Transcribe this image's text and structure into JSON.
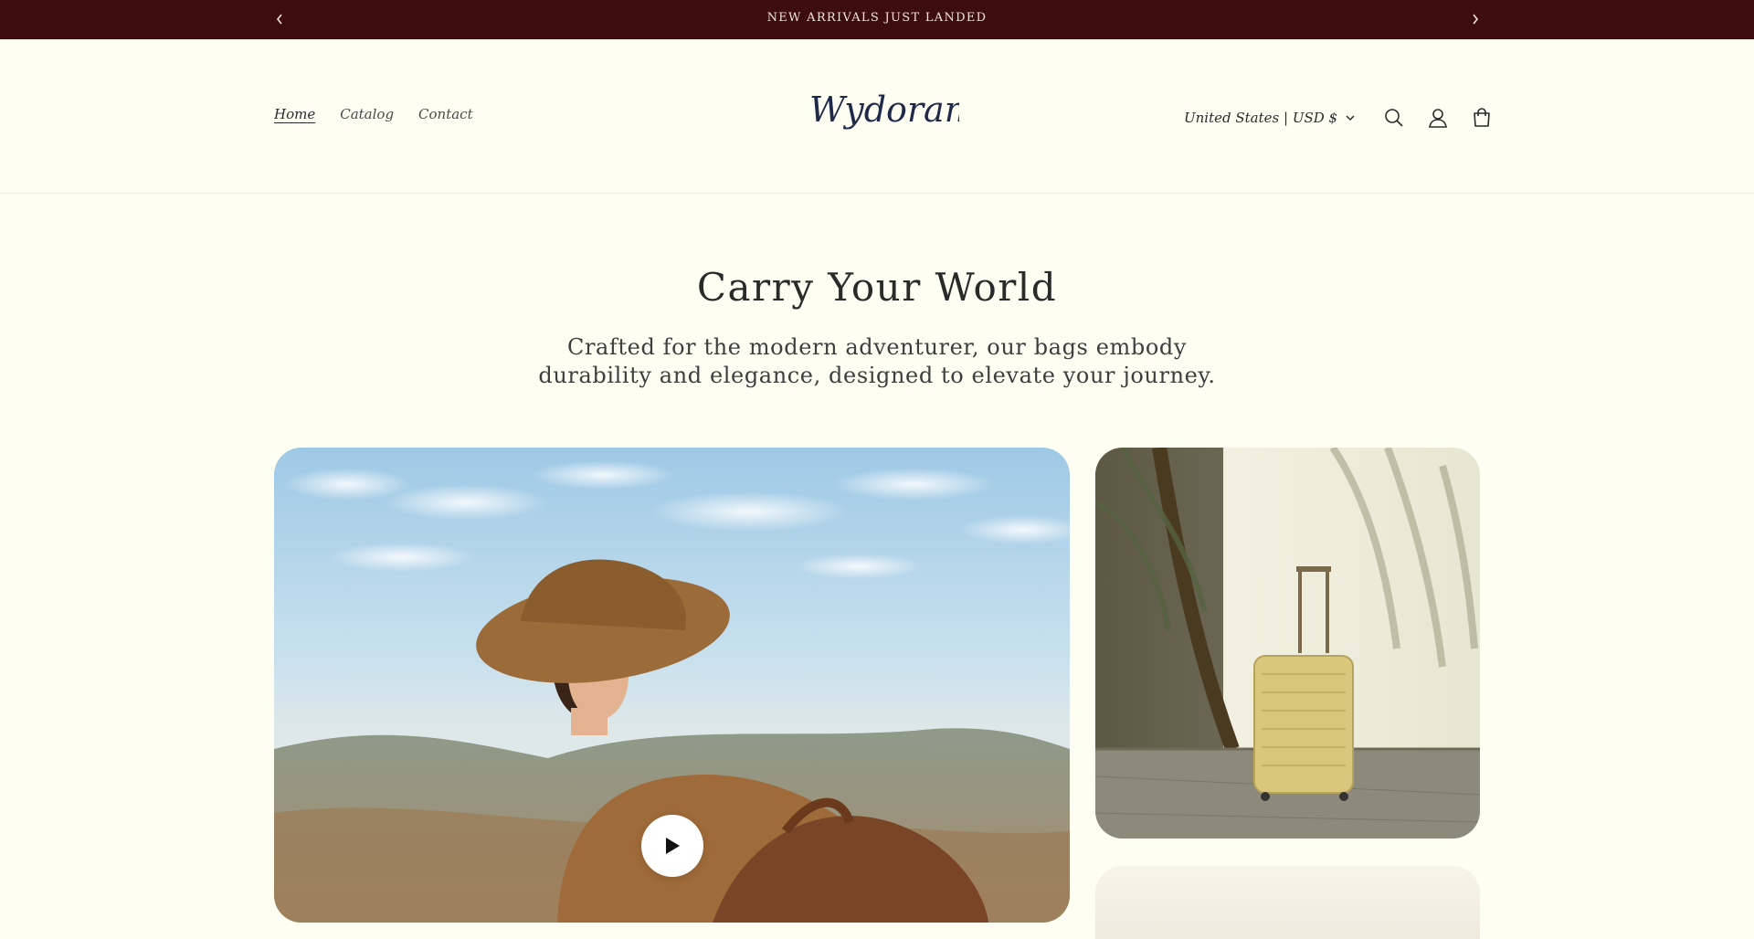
{
  "announcement": {
    "text": "NEW ARRIVALS JUST LANDED",
    "prev_icon": "chevron-left-icon",
    "next_icon": "chevron-right-icon"
  },
  "header": {
    "nav": [
      {
        "label": "Home",
        "active": true
      },
      {
        "label": "Catalog",
        "active": false
      },
      {
        "label": "Contact",
        "active": false
      }
    ],
    "logo_text": "Wydoramy",
    "country_selector": "United States | USD $",
    "icons": [
      "search-icon",
      "account-icon",
      "cart-icon"
    ]
  },
  "hero": {
    "title": "Carry Your World",
    "subtitle": "Crafted for the modern adventurer, our bags embody durability and elegance, designed to elevate your journey."
  },
  "media": {
    "main": "woman-with-hat-and-backpack-video",
    "side": "suitcase-by-palm-image",
    "play_icon": "play-icon"
  },
  "colors": {
    "announcement_bg": "#3d0c0c",
    "page_bg": "#fffef3",
    "logo": "#1f2a4a"
  }
}
